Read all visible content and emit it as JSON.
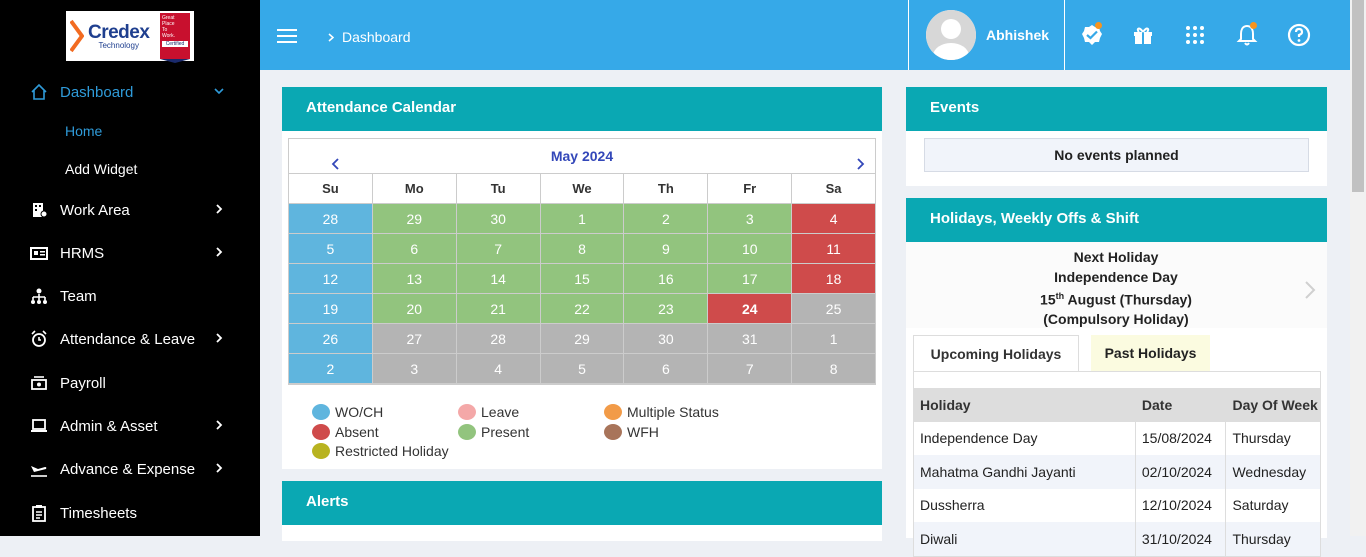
{
  "brand": {
    "name": "Credex",
    "sub": "Technology",
    "badge_lines": [
      "Great",
      "Place",
      "To",
      "Work.",
      "Certified"
    ]
  },
  "sidebar": {
    "items": [
      {
        "label": "Dashboard",
        "icon": "home-icon"
      },
      {
        "label": "Work Area",
        "icon": "building-icon"
      },
      {
        "label": "HRMS",
        "icon": "id-card-icon"
      },
      {
        "label": "Team",
        "icon": "team-icon"
      },
      {
        "label": "Attendance & Leave",
        "icon": "alarm-icon"
      },
      {
        "label": "Payroll",
        "icon": "money-icon"
      },
      {
        "label": "Admin & Asset",
        "icon": "laptop-icon"
      },
      {
        "label": "Advance & Expense",
        "icon": "plane-icon"
      },
      {
        "label": "Timesheets",
        "icon": "clipboard-icon"
      }
    ],
    "sub_items": [
      {
        "label": "Home"
      },
      {
        "label": "Add Widget"
      }
    ]
  },
  "header": {
    "breadcrumb": "Dashboard",
    "user_name": "Abhishek"
  },
  "attendance": {
    "title": "Attendance Calendar",
    "month": "May 2024",
    "weekdays": [
      "Su",
      "Mo",
      "Tu",
      "We",
      "Th",
      "Fr",
      "Sa"
    ],
    "weeks": [
      [
        "28",
        "29",
        "30",
        "1",
        "2",
        "3",
        "4"
      ],
      [
        "5",
        "6",
        "7",
        "8",
        "9",
        "10",
        "11"
      ],
      [
        "12",
        "13",
        "14",
        "15",
        "16",
        "17",
        "18"
      ],
      [
        "19",
        "20",
        "21",
        "22",
        "23",
        "24",
        "25"
      ],
      [
        "26",
        "27",
        "28",
        "29",
        "30",
        "31",
        "1"
      ],
      [
        "2",
        "3",
        "4",
        "5",
        "6",
        "7",
        "8"
      ]
    ],
    "legend": [
      {
        "label": "WO/CH",
        "color": "#5fb5de"
      },
      {
        "label": "Leave",
        "color": "#f4a8a8"
      },
      {
        "label": "Multiple Status",
        "color": "#f29b48"
      },
      {
        "label": "Absent",
        "color": "#cf4b4b"
      },
      {
        "label": "Present",
        "color": "#92c47e"
      },
      {
        "label": "WFH",
        "color": "#a8745a"
      },
      {
        "label": "Restricted Holiday",
        "color": "#b8b320"
      }
    ]
  },
  "alerts": {
    "title": "Alerts"
  },
  "events": {
    "title": "Events",
    "empty_text": "No events planned"
  },
  "holidays": {
    "title": "Holidays, Weekly Offs & Shift",
    "next_label": "Next Holiday",
    "next_name": "Independence Day",
    "next_date_day": "15",
    "next_date_sup": "th",
    "next_date_rest": " August (Thursday)",
    "next_type": "(Compulsory Holiday)",
    "tabs": [
      {
        "label": "Upcoming Holidays"
      },
      {
        "label": "Past Holidays"
      }
    ],
    "columns": [
      "Holiday",
      "Date",
      "Day Of Week"
    ],
    "rows": [
      [
        "Independence Day",
        "15/08/2024",
        "Thursday"
      ],
      [
        "Mahatma Gandhi Jayanti",
        "02/10/2024",
        "Wednesday"
      ],
      [
        "Dussherra",
        "12/10/2024",
        "Saturday"
      ],
      [
        "Diwali",
        "31/10/2024",
        "Thursday"
      ]
    ]
  },
  "colors": {
    "sidebar_bg": "#000000",
    "topbar": "#36a9e8",
    "card_header": "#0aa8b3",
    "wo": "#5fb5de",
    "present": "#92c47e",
    "absent": "#cf4b4b",
    "future": "#b4b4b4"
  }
}
